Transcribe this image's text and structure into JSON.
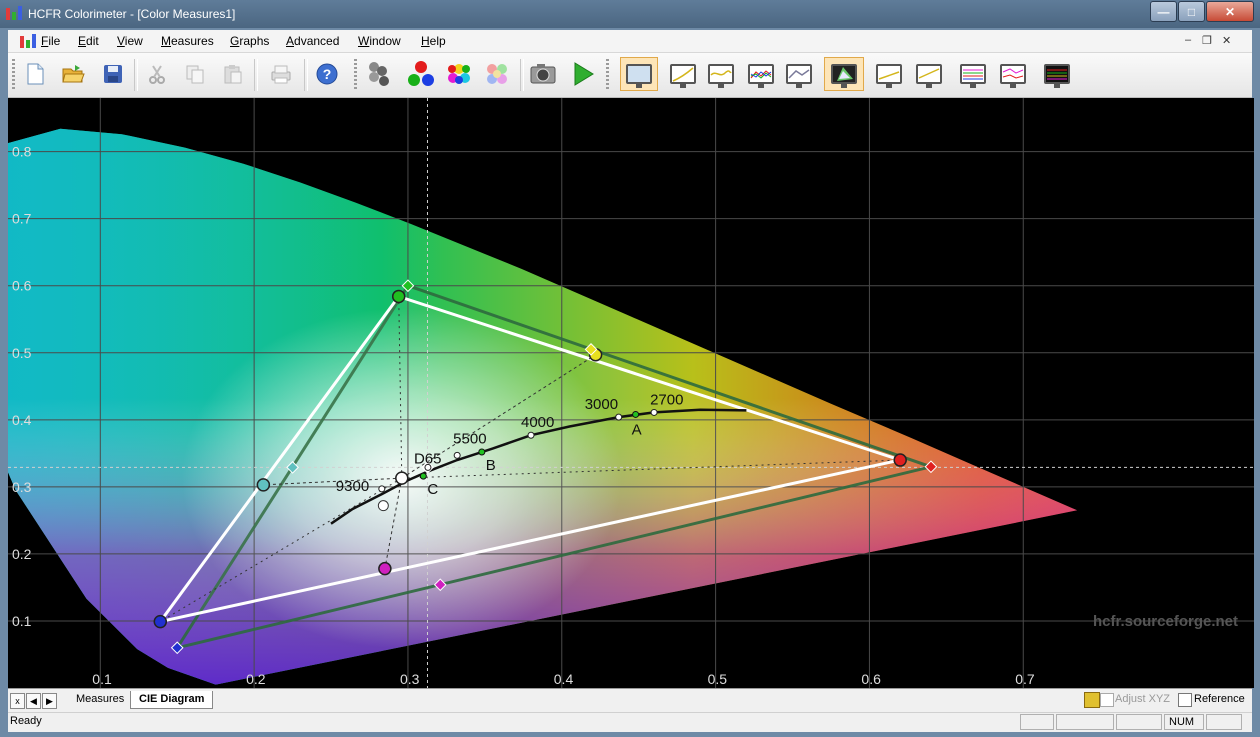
{
  "window": {
    "title": "HCFR Colorimeter - [Color Measures1]",
    "controls": {
      "minimize": "—",
      "maximize": "□",
      "close": "✕"
    }
  },
  "menu": {
    "items": [
      {
        "label": "File",
        "accel": "F"
      },
      {
        "label": "Edit",
        "accel": "E"
      },
      {
        "label": "View",
        "accel": "V"
      },
      {
        "label": "Measures",
        "accel": "M"
      },
      {
        "label": "Graphs",
        "accel": "G"
      },
      {
        "label": "Advanced",
        "accel": "A"
      },
      {
        "label": "Window",
        "accel": "W"
      },
      {
        "label": "Help",
        "accel": "H"
      }
    ],
    "mdi": {
      "minimize": "–",
      "restore": "❐",
      "close": "✕"
    }
  },
  "toolbar": {
    "buttons": [
      "new",
      "open",
      "save",
      "cut",
      "copy",
      "paste",
      "print",
      "help",
      "sensor",
      "rgb-measures",
      "color-measures",
      "saturation-measures",
      "capture",
      "run",
      "measures-view",
      "luminance-graph",
      "gamma-graph",
      "rgb-levels-graph",
      "color-temp-graph",
      "cie-diagram",
      "near-black-graph",
      "near-white-graph",
      "saturation-luminance-graph",
      "saturation-shift-graph",
      "color-checker-graph"
    ],
    "selected": [
      "measures-view",
      "cie-diagram"
    ]
  },
  "chart_data": {
    "type": "scatter",
    "title": "",
    "xlabel": "",
    "ylabel": "",
    "xlim": [
      0.04,
      0.85
    ],
    "ylim": [
      0.0,
      0.88
    ],
    "x_ticks": [
      "0.1",
      "0.2",
      "0.3",
      "0.4",
      "0.5",
      "0.6",
      "0.7"
    ],
    "y_ticks": [
      "0.1",
      "0.2",
      "0.3",
      "0.4",
      "0.5",
      "0.6",
      "0.7",
      "0.8"
    ],
    "grid": true,
    "watermark": "hcfr.sourceforge.net",
    "spectral_locus": [
      [
        0.175,
        0.005
      ],
      [
        0.144,
        0.03
      ],
      [
        0.124,
        0.058
      ],
      [
        0.091,
        0.133
      ],
      [
        0.045,
        0.295
      ],
      [
        0.023,
        0.413
      ],
      [
        0.008,
        0.538
      ],
      [
        0.004,
        0.655
      ],
      [
        0.014,
        0.75
      ],
      [
        0.039,
        0.812
      ],
      [
        0.074,
        0.834
      ],
      [
        0.114,
        0.826
      ],
      [
        0.155,
        0.806
      ],
      [
        0.193,
        0.782
      ],
      [
        0.23,
        0.754
      ],
      [
        0.266,
        0.724
      ],
      [
        0.302,
        0.692
      ],
      [
        0.374,
        0.625
      ],
      [
        0.444,
        0.555
      ],
      [
        0.512,
        0.487
      ],
      [
        0.575,
        0.424
      ],
      [
        0.627,
        0.373
      ],
      [
        0.669,
        0.331
      ],
      [
        0.735,
        0.265
      ]
    ],
    "reference_gamut": {
      "red": [
        0.64,
        0.33
      ],
      "green": [
        0.3,
        0.6
      ],
      "blue": [
        0.15,
        0.06
      ],
      "white": [
        0.3127,
        0.329
      ],
      "yellow": [
        0.419,
        0.505
      ],
      "cyan": [
        0.225,
        0.329
      ],
      "magenta": [
        0.321,
        0.154
      ]
    },
    "measured_gamut": {
      "red": [
        0.62,
        0.34
      ],
      "green": [
        0.294,
        0.584
      ],
      "blue": [
        0.139,
        0.099
      ],
      "white": [
        0.296,
        0.313
      ],
      "yellow": [
        0.422,
        0.497
      ],
      "cyan": [
        0.206,
        0.303
      ],
      "magenta": [
        0.285,
        0.178
      ]
    },
    "extra_point": [
      0.284,
      0.272
    ],
    "planckian_locus": [
      [
        0.25,
        0.245
      ],
      [
        0.264,
        0.267
      ],
      [
        0.282,
        0.288
      ],
      [
        0.3,
        0.31
      ],
      [
        0.314,
        0.324
      ],
      [
        0.332,
        0.34
      ],
      [
        0.355,
        0.357
      ],
      [
        0.38,
        0.377
      ],
      [
        0.405,
        0.39
      ],
      [
        0.437,
        0.404
      ],
      [
        0.46,
        0.411
      ],
      [
        0.49,
        0.415
      ],
      [
        0.52,
        0.414
      ]
    ],
    "cct_labels": [
      {
        "text": "9300",
        "pos": [
          0.283,
          0.297
        ]
      },
      {
        "text": "D65",
        "pos": [
          0.313,
          0.329
        ]
      },
      {
        "text": "5500",
        "pos": [
          0.332,
          0.347
        ]
      },
      {
        "text": "4000",
        "pos": [
          0.38,
          0.377
        ]
      },
      {
        "text": "3000",
        "pos": [
          0.437,
          0.404
        ]
      },
      {
        "text": "2700",
        "pos": [
          0.46,
          0.411
        ]
      }
    ],
    "illuminants": [
      {
        "text": "A",
        "pos": [
          0.448,
          0.408
        ]
      },
      {
        "text": "B",
        "pos": [
          0.348,
          0.352
        ]
      },
      {
        "text": "C",
        "pos": [
          0.31,
          0.316
        ]
      }
    ]
  },
  "tabs": {
    "nav": [
      "x",
      "◀",
      "▶"
    ],
    "items": [
      {
        "label": "Measures",
        "active": false
      },
      {
        "label": "CIE Diagram",
        "active": true
      }
    ]
  },
  "options": {
    "adjust_xyz": {
      "label": "Adjust XYZ",
      "checked": false,
      "enabled": false
    },
    "reference": {
      "label": "Reference",
      "checked": false
    }
  },
  "status": {
    "text": "Ready",
    "num": "NUM"
  }
}
